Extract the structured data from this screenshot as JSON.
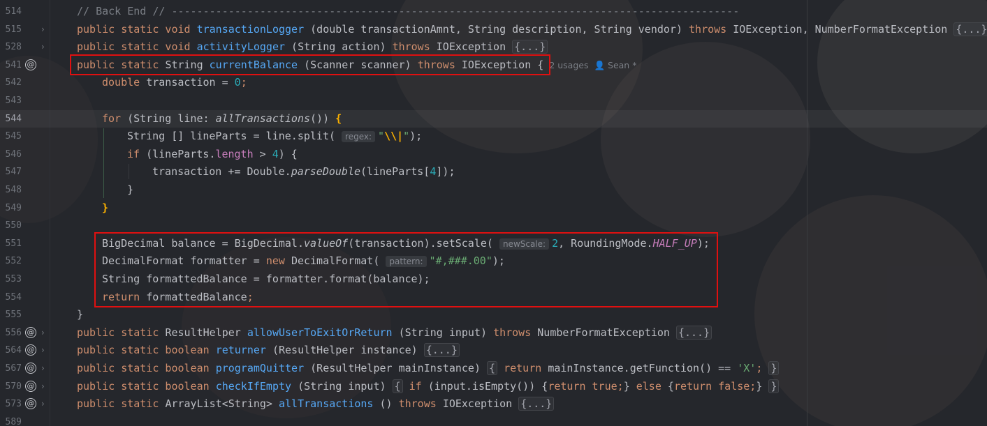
{
  "lines": [
    {
      "num": "514",
      "parts": [
        [
          "cmt",
          "// Back End // ------------------------------------------------------------------------------------------"
        ]
      ]
    },
    {
      "num": "515",
      "fold": true,
      "parts": [
        [
          "kw",
          "public static void "
        ],
        [
          "fn",
          "transactionLogger"
        ],
        [
          "",
          " (double transactionAmnt, String description, String vendor) "
        ],
        [
          "kw",
          "throws "
        ],
        [
          "",
          "IOException, NumberFormatException "
        ],
        [
          "fold",
          "{...}"
        ]
      ]
    },
    {
      "num": "528",
      "fold": true,
      "parts": [
        [
          "kw",
          "public static void "
        ],
        [
          "fn",
          "activityLogger"
        ],
        [
          "",
          " (String action) "
        ],
        [
          "kw",
          "throws "
        ],
        [
          "",
          "IOException "
        ],
        [
          "fold",
          "{...}"
        ]
      ]
    },
    {
      "num": "541",
      "at": true,
      "parts": [
        [
          "kw",
          "public static "
        ],
        [
          "",
          "String "
        ],
        [
          "fn",
          "currentBalance"
        ],
        [
          "",
          " (Scanner scanner) "
        ],
        [
          "kw",
          "throws "
        ],
        [
          "",
          "IOException {"
        ],
        [
          "inlay",
          "2 usages"
        ],
        [
          "inlay",
          "👤 Sean *"
        ]
      ]
    },
    {
      "num": "542",
      "indent": 1,
      "parts": [
        [
          "kw",
          "double "
        ],
        [
          "",
          "transaction = "
        ],
        [
          "num",
          "0"
        ],
        [
          "kw",
          ";"
        ]
      ]
    },
    {
      "num": "543",
      "parts": []
    },
    {
      "num": "544",
      "indent": 1,
      "current": true,
      "parts": [
        [
          "kw",
          "for "
        ],
        [
          "",
          "(String line: "
        ],
        [
          "ital",
          "allTransactions"
        ],
        [
          "",
          "()) "
        ],
        [
          "yel",
          "{"
        ]
      ]
    },
    {
      "num": "545",
      "indent": 2,
      "parts": [
        [
          "",
          "String [] lineParts = line.split( "
        ],
        [
          "hint",
          "regex:"
        ],
        [
          "str",
          "\""
        ],
        [
          "yel",
          "\\\\|"
        ],
        [
          "str",
          "\""
        ],
        [
          "",
          ");"
        ]
      ]
    },
    {
      "num": "546",
      "indent": 2,
      "parts": [
        [
          "kw",
          "if "
        ],
        [
          "",
          "(lineParts."
        ],
        [
          "fld",
          "length"
        ],
        [
          "",
          " > "
        ],
        [
          "num",
          "4"
        ],
        [
          "",
          ") {"
        ]
      ]
    },
    {
      "num": "547",
      "indent": 3,
      "parts": [
        [
          "",
          "transaction += Double."
        ],
        [
          "ital",
          "parseDouble"
        ],
        [
          "",
          "(lineParts["
        ],
        [
          "num",
          "4"
        ],
        [
          "",
          "]);"
        ]
      ]
    },
    {
      "num": "548",
      "indent": 2,
      "parts": [
        [
          "",
          "}"
        ]
      ]
    },
    {
      "num": "549",
      "indent": 1,
      "parts": [
        [
          "yel",
          "}"
        ]
      ]
    },
    {
      "num": "550",
      "parts": []
    },
    {
      "num": "551",
      "indent": 1,
      "parts": [
        [
          "",
          "BigDecimal balance = BigDecimal."
        ],
        [
          "ital",
          "valueOf"
        ],
        [
          "",
          "(transaction).setScale( "
        ],
        [
          "hint",
          "newScale:"
        ],
        [
          "num",
          "2"
        ],
        [
          "",
          ", RoundingMode."
        ],
        [
          "const",
          "HALF_UP"
        ],
        [
          "",
          ");"
        ]
      ]
    },
    {
      "num": "552",
      "indent": 1,
      "parts": [
        [
          "",
          "DecimalFormat formatter = "
        ],
        [
          "kw",
          "new "
        ],
        [
          "",
          "DecimalFormat( "
        ],
        [
          "hint",
          "pattern:"
        ],
        [
          "str",
          "\"#,###.00\""
        ],
        [
          "",
          ");"
        ]
      ]
    },
    {
      "num": "553",
      "indent": 1,
      "parts": [
        [
          "",
          "String formattedBalance = formatter.format(balance);"
        ]
      ]
    },
    {
      "num": "554",
      "indent": 1,
      "parts": [
        [
          "kw",
          "return "
        ],
        [
          "",
          "formattedBalance"
        ],
        [
          "kw",
          ";"
        ]
      ]
    },
    {
      "num": "555",
      "parts": [
        [
          "",
          "}"
        ]
      ]
    },
    {
      "num": "556",
      "at": true,
      "fold": true,
      "parts": [
        [
          "kw",
          "public static "
        ],
        [
          "",
          "ResultHelper "
        ],
        [
          "fn",
          "allowUserToExitOrReturn"
        ],
        [
          "",
          " (String input) "
        ],
        [
          "kw",
          "throws "
        ],
        [
          "",
          "NumberFormatException "
        ],
        [
          "fold",
          "{...}"
        ]
      ]
    },
    {
      "num": "564",
      "at": true,
      "fold": true,
      "parts": [
        [
          "kw",
          "public static boolean "
        ],
        [
          "fn",
          "returner"
        ],
        [
          "",
          " (ResultHelper instance) "
        ],
        [
          "fold",
          "{...}"
        ]
      ]
    },
    {
      "num": "567",
      "at": true,
      "fold": true,
      "parts": [
        [
          "kw",
          "public static boolean "
        ],
        [
          "fn",
          "programQuitter"
        ],
        [
          "",
          " (ResultHelper mainInstance) "
        ],
        [
          "fold",
          "{"
        ],
        [
          "kw",
          " return "
        ],
        [
          "",
          "mainInstance.getFunction() == "
        ],
        [
          "str",
          "'X'"
        ],
        [
          "kw",
          "; "
        ],
        [
          "fold",
          "}"
        ]
      ]
    },
    {
      "num": "570",
      "at": true,
      "fold": true,
      "parts": [
        [
          "kw",
          "public static boolean "
        ],
        [
          "fn",
          "checkIfEmpty"
        ],
        [
          "",
          " (String input) "
        ],
        [
          "fold",
          "{"
        ],
        [
          "kw",
          " if "
        ],
        [
          "",
          "(input.isEmpty()) {"
        ],
        [
          "kw",
          "return true;"
        ],
        [
          "",
          "} "
        ],
        [
          "kw",
          "else "
        ],
        [
          "",
          "{"
        ],
        [
          "kw",
          "return false;"
        ],
        [
          "",
          "} "
        ],
        [
          "fold",
          "}"
        ]
      ]
    },
    {
      "num": "573",
      "at": true,
      "fold": true,
      "parts": [
        [
          "kw",
          "public static "
        ],
        [
          "",
          "ArrayList<String> "
        ],
        [
          "fn",
          "allTransactions"
        ],
        [
          "",
          " () "
        ],
        [
          "kw",
          "throws "
        ],
        [
          "",
          "IOException "
        ],
        [
          "fold",
          "{...}"
        ]
      ]
    },
    {
      "num": "589",
      "parts": []
    }
  ]
}
